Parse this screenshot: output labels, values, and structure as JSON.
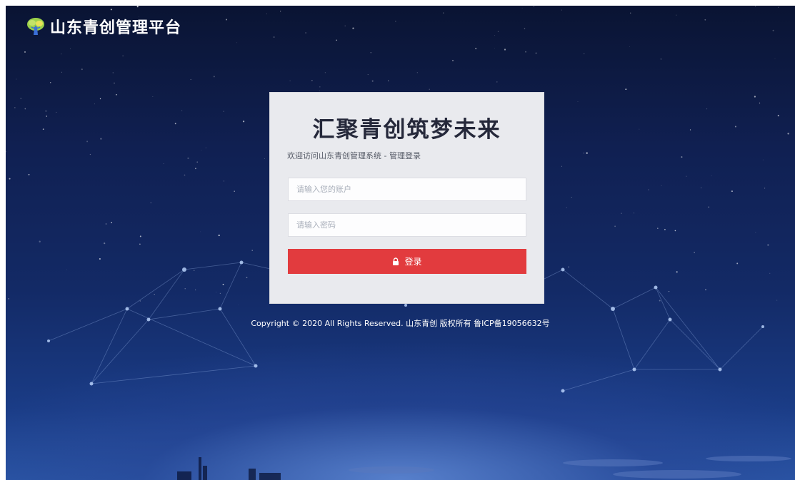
{
  "header": {
    "logo_text": "山东青创管理平台",
    "logo_icon": "tree-logo-icon"
  },
  "login": {
    "title": "汇聚青创筑梦未来",
    "subtitle": "欢迎访问山东青创管理系统 - 管理登录",
    "username_placeholder": "请输入您的账户",
    "username_value": "",
    "password_placeholder": "请输入密码",
    "password_value": "",
    "button_label": "登录",
    "button_icon": "lock-icon"
  },
  "footer": {
    "copyright": "Copyright © 2020 All Rights Reserved. 山东青创 版权所有 鲁ICP备19056632号"
  },
  "colors": {
    "accent": "#e23b3e",
    "card_bg": "#e9eaee",
    "sky_top": "#0a1433",
    "sky_bottom": "#2a56a6"
  }
}
